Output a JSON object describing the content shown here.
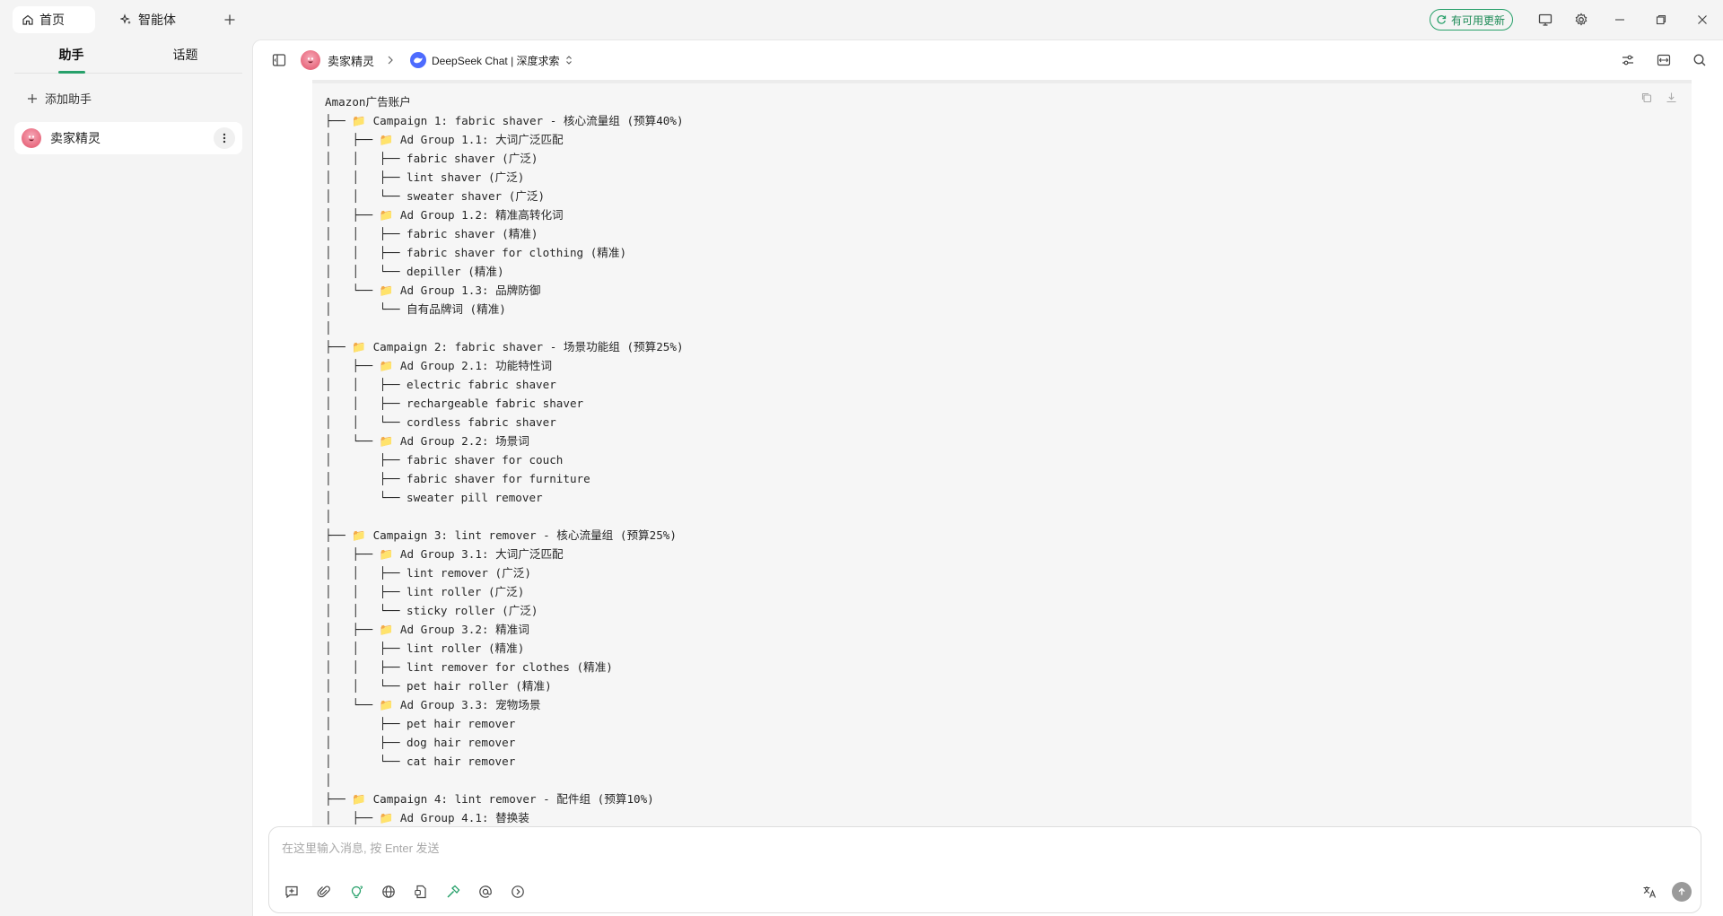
{
  "titlebar": {
    "tabs": [
      {
        "label": "首页",
        "icon": "home-icon",
        "active": true
      },
      {
        "label": "智能体",
        "icon": "sparkle-icon",
        "active": false
      }
    ],
    "update_label": "有可用更新"
  },
  "sidebar": {
    "tabs": [
      {
        "label": "助手",
        "active": true
      },
      {
        "label": "话题",
        "active": false
      }
    ],
    "add_assistant_label": "添加助手",
    "assistants": [
      {
        "name": "卖家精灵"
      }
    ]
  },
  "header": {
    "assistant_name": "卖家精灵",
    "model_label": "DeepSeek Chat | 深度求索"
  },
  "code_lines": [
    "Amazon广告账户",
    "├── 📁 Campaign 1: fabric shaver - 核心流量组 (预算40%)",
    "│   ├── 📁 Ad Group 1.1: 大词广泛匹配",
    "│   │   ├── fabric shaver (广泛)",
    "│   │   ├── lint shaver (广泛)",
    "│   │   └── sweater shaver (广泛)",
    "│   ├── 📁 Ad Group 1.2: 精准高转化词",
    "│   │   ├── fabric shaver (精准)",
    "│   │   ├── fabric shaver for clothing (精准)",
    "│   │   └── depiller (精准)",
    "│   └── 📁 Ad Group 1.3: 品牌防御",
    "│       └── 自有品牌词 (精准)",
    "│",
    "├── 📁 Campaign 2: fabric shaver - 场景功能组 (预算25%)",
    "│   ├── 📁 Ad Group 2.1: 功能特性词",
    "│   │   ├── electric fabric shaver",
    "│   │   ├── rechargeable fabric shaver",
    "│   │   └── cordless fabric shaver",
    "│   └── 📁 Ad Group 2.2: 场景词",
    "│       ├── fabric shaver for couch",
    "│       ├── fabric shaver for furniture",
    "│       └── sweater pill remover",
    "│",
    "├── 📁 Campaign 3: lint remover - 核心流量组 (预算25%)",
    "│   ├── 📁 Ad Group 3.1: 大词广泛匹配",
    "│   │   ├── lint remover (广泛)",
    "│   │   ├── lint roller (广泛)",
    "│   │   └── sticky roller (广泛)",
    "│   ├── 📁 Ad Group 3.2: 精准词",
    "│   │   ├── lint roller (精准)",
    "│   │   ├── lint remover for clothes (精准)",
    "│   │   └── pet hair roller (精准)",
    "│   └── 📁 Ad Group 3.3: 宠物场景",
    "│       ├── pet hair remover",
    "│       ├── dog hair remover",
    "│       └── cat hair remover",
    "│",
    "├── 📁 Campaign 4: lint remover - 配件组 (预算10%)",
    "│   ├── 📁 Ad Group 4.1: 替换装"
  ],
  "composer": {
    "placeholder": "在这里输入消息, 按 Enter 发送"
  },
  "colors": {
    "accent": "#27a06a",
    "panel": "#ffffff",
    "background": "#f4f4f4",
    "code_background": "#f6f6f6"
  }
}
